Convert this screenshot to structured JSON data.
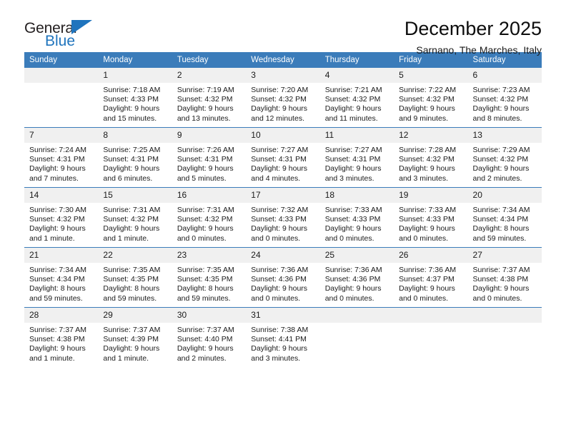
{
  "brand": {
    "name_part1": "General",
    "name_part2": "Blue",
    "triangle_color": "#1f74bd"
  },
  "header": {
    "title": "December 2025",
    "subtitle": "Sarnano, The Marches, Italy"
  },
  "theme": {
    "header_row_color": "#3b7cba",
    "daynum_bg": "#f0f0f0",
    "text_color": "#1a1a1a",
    "page_bg": "#ffffff"
  },
  "calendar": {
    "weekday_headers": [
      "Sunday",
      "Monday",
      "Tuesday",
      "Wednesday",
      "Thursday",
      "Friday",
      "Saturday"
    ],
    "labels": {
      "sunrise_prefix": "Sunrise:",
      "sunset_prefix": "Sunset:",
      "daylight_prefix": "Daylight:"
    },
    "weeks": [
      [
        {
          "day": "",
          "blank": true
        },
        {
          "day": "1",
          "sunrise": "Sunrise: 7:18 AM",
          "sunset": "Sunset: 4:33 PM",
          "daylight": "Daylight: 9 hours and 15 minutes."
        },
        {
          "day": "2",
          "sunrise": "Sunrise: 7:19 AM",
          "sunset": "Sunset: 4:32 PM",
          "daylight": "Daylight: 9 hours and 13 minutes."
        },
        {
          "day": "3",
          "sunrise": "Sunrise: 7:20 AM",
          "sunset": "Sunset: 4:32 PM",
          "daylight": "Daylight: 9 hours and 12 minutes."
        },
        {
          "day": "4",
          "sunrise": "Sunrise: 7:21 AM",
          "sunset": "Sunset: 4:32 PM",
          "daylight": "Daylight: 9 hours and 11 minutes."
        },
        {
          "day": "5",
          "sunrise": "Sunrise: 7:22 AM",
          "sunset": "Sunset: 4:32 PM",
          "daylight": "Daylight: 9 hours and 9 minutes."
        },
        {
          "day": "6",
          "sunrise": "Sunrise: 7:23 AM",
          "sunset": "Sunset: 4:32 PM",
          "daylight": "Daylight: 9 hours and 8 minutes."
        }
      ],
      [
        {
          "day": "7",
          "sunrise": "Sunrise: 7:24 AM",
          "sunset": "Sunset: 4:31 PM",
          "daylight": "Daylight: 9 hours and 7 minutes."
        },
        {
          "day": "8",
          "sunrise": "Sunrise: 7:25 AM",
          "sunset": "Sunset: 4:31 PM",
          "daylight": "Daylight: 9 hours and 6 minutes."
        },
        {
          "day": "9",
          "sunrise": "Sunrise: 7:26 AM",
          "sunset": "Sunset: 4:31 PM",
          "daylight": "Daylight: 9 hours and 5 minutes."
        },
        {
          "day": "10",
          "sunrise": "Sunrise: 7:27 AM",
          "sunset": "Sunset: 4:31 PM",
          "daylight": "Daylight: 9 hours and 4 minutes."
        },
        {
          "day": "11",
          "sunrise": "Sunrise: 7:27 AM",
          "sunset": "Sunset: 4:31 PM",
          "daylight": "Daylight: 9 hours and 3 minutes."
        },
        {
          "day": "12",
          "sunrise": "Sunrise: 7:28 AM",
          "sunset": "Sunset: 4:32 PM",
          "daylight": "Daylight: 9 hours and 3 minutes."
        },
        {
          "day": "13",
          "sunrise": "Sunrise: 7:29 AM",
          "sunset": "Sunset: 4:32 PM",
          "daylight": "Daylight: 9 hours and 2 minutes."
        }
      ],
      [
        {
          "day": "14",
          "sunrise": "Sunrise: 7:30 AM",
          "sunset": "Sunset: 4:32 PM",
          "daylight": "Daylight: 9 hours and 1 minute."
        },
        {
          "day": "15",
          "sunrise": "Sunrise: 7:31 AM",
          "sunset": "Sunset: 4:32 PM",
          "daylight": "Daylight: 9 hours and 1 minute."
        },
        {
          "day": "16",
          "sunrise": "Sunrise: 7:31 AM",
          "sunset": "Sunset: 4:32 PM",
          "daylight": "Daylight: 9 hours and 0 minutes."
        },
        {
          "day": "17",
          "sunrise": "Sunrise: 7:32 AM",
          "sunset": "Sunset: 4:33 PM",
          "daylight": "Daylight: 9 hours and 0 minutes."
        },
        {
          "day": "18",
          "sunrise": "Sunrise: 7:33 AM",
          "sunset": "Sunset: 4:33 PM",
          "daylight": "Daylight: 9 hours and 0 minutes."
        },
        {
          "day": "19",
          "sunrise": "Sunrise: 7:33 AM",
          "sunset": "Sunset: 4:33 PM",
          "daylight": "Daylight: 9 hours and 0 minutes."
        },
        {
          "day": "20",
          "sunrise": "Sunrise: 7:34 AM",
          "sunset": "Sunset: 4:34 PM",
          "daylight": "Daylight: 8 hours and 59 minutes."
        }
      ],
      [
        {
          "day": "21",
          "sunrise": "Sunrise: 7:34 AM",
          "sunset": "Sunset: 4:34 PM",
          "daylight": "Daylight: 8 hours and 59 minutes."
        },
        {
          "day": "22",
          "sunrise": "Sunrise: 7:35 AM",
          "sunset": "Sunset: 4:35 PM",
          "daylight": "Daylight: 8 hours and 59 minutes."
        },
        {
          "day": "23",
          "sunrise": "Sunrise: 7:35 AM",
          "sunset": "Sunset: 4:35 PM",
          "daylight": "Daylight: 8 hours and 59 minutes."
        },
        {
          "day": "24",
          "sunrise": "Sunrise: 7:36 AM",
          "sunset": "Sunset: 4:36 PM",
          "daylight": "Daylight: 9 hours and 0 minutes."
        },
        {
          "day": "25",
          "sunrise": "Sunrise: 7:36 AM",
          "sunset": "Sunset: 4:36 PM",
          "daylight": "Daylight: 9 hours and 0 minutes."
        },
        {
          "day": "26",
          "sunrise": "Sunrise: 7:36 AM",
          "sunset": "Sunset: 4:37 PM",
          "daylight": "Daylight: 9 hours and 0 minutes."
        },
        {
          "day": "27",
          "sunrise": "Sunrise: 7:37 AM",
          "sunset": "Sunset: 4:38 PM",
          "daylight": "Daylight: 9 hours and 0 minutes."
        }
      ],
      [
        {
          "day": "28",
          "sunrise": "Sunrise: 7:37 AM",
          "sunset": "Sunset: 4:38 PM",
          "daylight": "Daylight: 9 hours and 1 minute."
        },
        {
          "day": "29",
          "sunrise": "Sunrise: 7:37 AM",
          "sunset": "Sunset: 4:39 PM",
          "daylight": "Daylight: 9 hours and 1 minute."
        },
        {
          "day": "30",
          "sunrise": "Sunrise: 7:37 AM",
          "sunset": "Sunset: 4:40 PM",
          "daylight": "Daylight: 9 hours and 2 minutes."
        },
        {
          "day": "31",
          "sunrise": "Sunrise: 7:38 AM",
          "sunset": "Sunset: 4:41 PM",
          "daylight": "Daylight: 9 hours and 3 minutes."
        },
        {
          "day": "",
          "blank": true
        },
        {
          "day": "",
          "blank": true
        },
        {
          "day": "",
          "blank": true
        }
      ]
    ]
  }
}
